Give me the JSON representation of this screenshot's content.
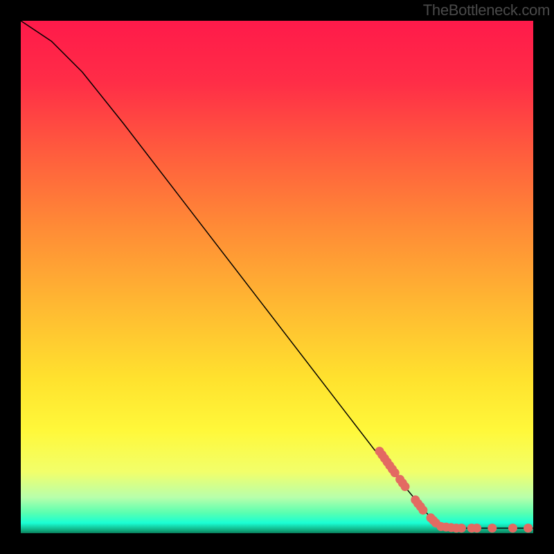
{
  "watermark": "TheBottleneck.com",
  "chart_data": {
    "type": "line",
    "title": "",
    "xlabel": "",
    "ylabel": "",
    "xlim": [
      0,
      100
    ],
    "ylim": [
      0,
      100
    ],
    "curve": [
      {
        "x": 0,
        "y": 100
      },
      {
        "x": 6,
        "y": 96
      },
      {
        "x": 12,
        "y": 90
      },
      {
        "x": 20,
        "y": 80
      },
      {
        "x": 30,
        "y": 67
      },
      {
        "x": 40,
        "y": 54
      },
      {
        "x": 50,
        "y": 41
      },
      {
        "x": 60,
        "y": 28
      },
      {
        "x": 70,
        "y": 15
      },
      {
        "x": 80,
        "y": 3
      },
      {
        "x": 82,
        "y": 1.3
      },
      {
        "x": 85,
        "y": 1
      },
      {
        "x": 90,
        "y": 1
      },
      {
        "x": 95,
        "y": 1
      },
      {
        "x": 100,
        "y": 1
      }
    ],
    "markers": [
      {
        "x": 70.0,
        "y": 16.0
      },
      {
        "x": 70.5,
        "y": 15.3
      },
      {
        "x": 71.0,
        "y": 14.6
      },
      {
        "x": 71.5,
        "y": 13.9
      },
      {
        "x": 72.0,
        "y": 13.2
      },
      {
        "x": 72.5,
        "y": 12.5
      },
      {
        "x": 73.0,
        "y": 11.8
      },
      {
        "x": 74.0,
        "y": 10.5
      },
      {
        "x": 74.5,
        "y": 9.8
      },
      {
        "x": 75.0,
        "y": 9.1
      },
      {
        "x": 77.0,
        "y": 6.5
      },
      {
        "x": 77.5,
        "y": 5.8
      },
      {
        "x": 78.0,
        "y": 5.2
      },
      {
        "x": 78.5,
        "y": 4.5
      },
      {
        "x": 80.0,
        "y": 3.0
      },
      {
        "x": 80.5,
        "y": 2.5
      },
      {
        "x": 81.0,
        "y": 2.0
      },
      {
        "x": 82.0,
        "y": 1.3
      },
      {
        "x": 83.0,
        "y": 1.2
      },
      {
        "x": 84.0,
        "y": 1.1
      },
      {
        "x": 85.0,
        "y": 1.0
      },
      {
        "x": 86.0,
        "y": 1.0
      },
      {
        "x": 88.0,
        "y": 1.0
      },
      {
        "x": 89.0,
        "y": 1.0
      },
      {
        "x": 92.0,
        "y": 1.0
      },
      {
        "x": 96.0,
        "y": 1.0
      },
      {
        "x": 99.0,
        "y": 1.0
      }
    ],
    "gradient_stops": [
      {
        "offset": 0,
        "color": "#ff1a4a"
      },
      {
        "offset": 12,
        "color": "#ff2d47"
      },
      {
        "offset": 25,
        "color": "#ff5a3e"
      },
      {
        "offset": 40,
        "color": "#ff8a36"
      },
      {
        "offset": 55,
        "color": "#ffb732"
      },
      {
        "offset": 70,
        "color": "#ffe22e"
      },
      {
        "offset": 80,
        "color": "#fff83a"
      },
      {
        "offset": 88,
        "color": "#f2ff6a"
      },
      {
        "offset": 93,
        "color": "#b8ffab"
      },
      {
        "offset": 96,
        "color": "#5affb0"
      },
      {
        "offset": 98,
        "color": "#1affd4"
      },
      {
        "offset": 99.5,
        "color": "#0fa87c"
      },
      {
        "offset": 100,
        "color": "#0a7a5a"
      }
    ],
    "marker_color": "#e36a62",
    "curve_color": "#000000"
  }
}
